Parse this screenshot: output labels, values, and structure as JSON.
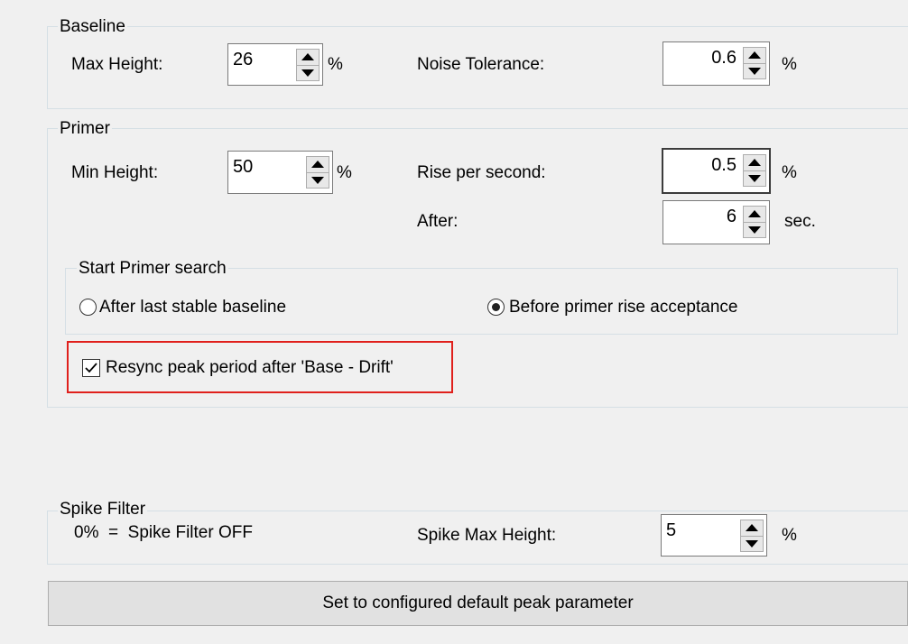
{
  "baseline": {
    "title": "Baseline",
    "max_height_label": "Max Height:",
    "max_height_value": "26",
    "max_height_unit": "%",
    "noise_label": "Noise Tolerance:",
    "noise_value": "0.6",
    "noise_unit": "%"
  },
  "primer": {
    "title": "Primer",
    "min_height_label": "Min Height:",
    "min_height_value": "50",
    "min_height_unit": "%",
    "rise_label": "Rise per second:",
    "rise_value": "0.5",
    "rise_unit": "%",
    "after_label": "After:",
    "after_value": "6",
    "after_unit": "sec.",
    "search": {
      "title": "Start Primer search",
      "option_after": "After last stable baseline",
      "option_before": "Before primer rise acceptance",
      "selected": "Before primer rise acceptance"
    },
    "resync_label": "Resync peak period after 'Base - Drift'",
    "resync_checked": true
  },
  "spike": {
    "title": "Spike Filter",
    "note": "0%  =  Spike Filter OFF",
    "max_label": "Spike Max Height:",
    "max_value": "5",
    "max_unit": "%"
  },
  "default_button": "Set to configured default peak parameter",
  "colors": {
    "highlight": "#e0201c",
    "background": "#f0f0f0"
  }
}
